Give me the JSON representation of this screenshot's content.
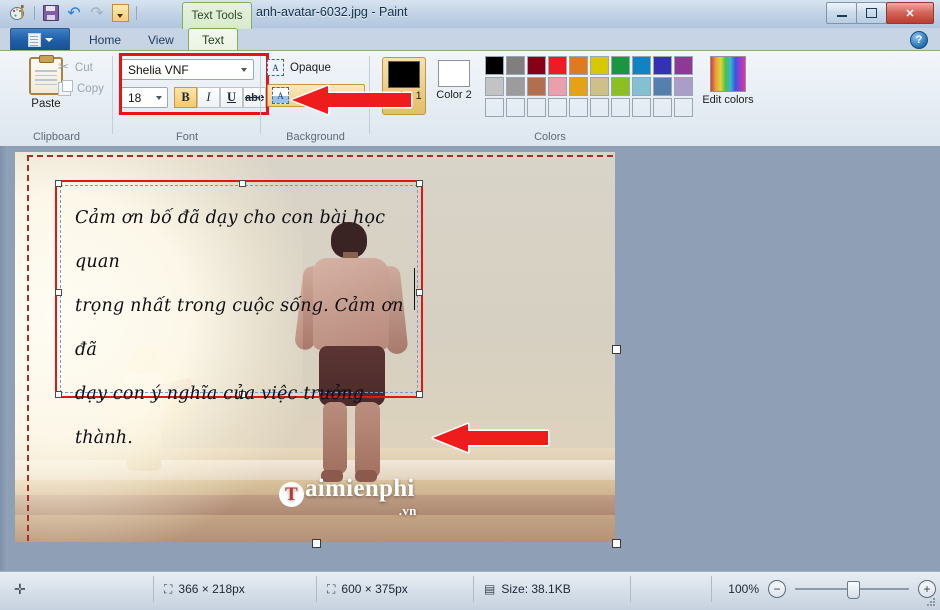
{
  "window": {
    "title": "anh-avatar-6032.jpg - Paint",
    "contextual_tab": "Text Tools",
    "minimize": "Minimize",
    "maximize": "Maximize",
    "close": "Close",
    "help": "?"
  },
  "quick_access": {
    "items": [
      {
        "name": "paint-app-icon",
        "label": "Paint"
      },
      {
        "name": "save-icon",
        "label": "Save"
      },
      {
        "name": "undo-icon",
        "label": "Undo"
      },
      {
        "name": "redo-icon",
        "label": "Redo"
      },
      {
        "name": "customize-qat-icon",
        "label": "Customize Quick Access Toolbar"
      }
    ]
  },
  "tabs": {
    "file_menu": "File",
    "items": [
      {
        "label": "Home",
        "active": false
      },
      {
        "label": "View",
        "active": false
      },
      {
        "label": "Text",
        "active": true
      }
    ]
  },
  "ribbon": {
    "clipboard": {
      "group_label": "Clipboard",
      "paste": "Paste",
      "cut": "Cut",
      "copy": "Copy"
    },
    "font": {
      "group_label": "Font",
      "font_family": "Shelia VNF",
      "font_size": "18",
      "bold": "B",
      "italic": "I",
      "underline": "U",
      "strikethrough": "abc"
    },
    "background": {
      "group_label": "Background",
      "opaque": "Opaque",
      "transparent": ""
    },
    "colors": {
      "group_label": "Colors",
      "color1_label": "Color 1",
      "color2_label": "Color 2",
      "color1_value": "#000000",
      "color2_value": "#ffffff",
      "edit_colors": "Edit colors",
      "row1": [
        "#000000",
        "#7f7f7f",
        "#880015",
        "#ed1c24",
        "#e07a1f",
        "#d8c800",
        "#1a9641",
        "#0f83c4",
        "#3432b0",
        "#8e3a95"
      ],
      "row2": [
        "#c3c3c3",
        "#9c9c9c",
        "#b07050",
        "#e8a0ac",
        "#e4a215",
        "#cfc08a",
        "#8cc020",
        "#84c0cf",
        "#5580ae",
        "#a89ec8"
      ],
      "row3": [
        "",
        "",
        "",
        "",
        "",
        "",
        "",
        "",
        "",
        ""
      ]
    }
  },
  "canvas": {
    "text_content": {
      "line1": "Cảm ơn bố đã dạy cho con bài học quan",
      "line2": "trọng nhất trong cuộc sống. Cảm ơn đã",
      "line3": "dạy con ý nghĩa của việc trưởng thành."
    },
    "watermark": {
      "main": "aimienphi",
      "badge": "T",
      "suffix": ".vn"
    }
  },
  "status_bar": {
    "cursor_icon": "move-cursor-icon",
    "selection_size": "366 × 218px",
    "image_size": "600 × 375px",
    "file_size": "Size: 38.1KB",
    "zoom_level": "100%",
    "zoom_out": "−",
    "zoom_in": "+"
  },
  "annotations": {
    "arrow_ribbon": "red-arrow-pointing-to-transparent-background-button",
    "arrow_canvas": "red-arrow-pointing-to-text-box",
    "highlight_font_group": "red-rectangle-around-font-group",
    "highlight_text_box": "red-rectangle-around-text-box"
  }
}
